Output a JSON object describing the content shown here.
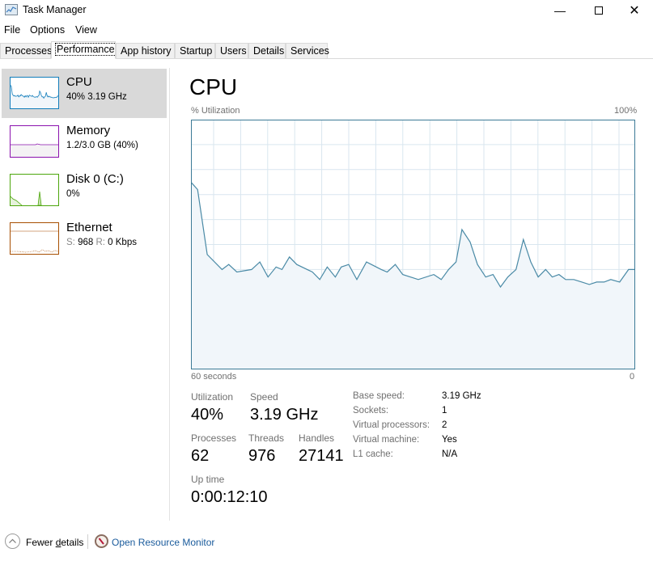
{
  "window": {
    "title": "Task Manager",
    "controls": [
      "minimize",
      "maximize",
      "close"
    ]
  },
  "menu": [
    "File",
    "Options",
    "View"
  ],
  "tabs": [
    {
      "label": "Processes",
      "active": false
    },
    {
      "label": "Performance",
      "active": true
    },
    {
      "label": "App history",
      "active": false
    },
    {
      "label": "Startup",
      "active": false
    },
    {
      "label": "Users",
      "active": false
    },
    {
      "label": "Details",
      "active": false
    },
    {
      "label": "Services",
      "active": false
    }
  ],
  "sidebar": {
    "items": [
      {
        "name": "CPU",
        "detail": "40% 3.19 GHz",
        "color": "#117dbb",
        "selected": true
      },
      {
        "name": "Memory",
        "detail": "1.2/3.0 GB (40%)",
        "color": "#8b12ae",
        "selected": false
      },
      {
        "name": "Disk 0 (C:)",
        "detail": "0%",
        "color": "#4da60c",
        "selected": false
      },
      {
        "name": "Ethernet",
        "detail_s_label": "S:",
        "detail_s_value": "968",
        "detail_r_label": "R:",
        "detail_r_value": "0 Kbps",
        "color": "#a74f01",
        "selected": false
      }
    ]
  },
  "main": {
    "title": "CPU",
    "y_label": "% Utilization",
    "y_max_label": "100%",
    "x_left_label": "60 seconds",
    "x_right_label": "0",
    "stats": {
      "utilization_label": "Utilization",
      "utilization_value": "40%",
      "speed_label": "Speed",
      "speed_value": "3.19 GHz",
      "processes_label": "Processes",
      "processes_value": "62",
      "threads_label": "Threads",
      "threads_value": "976",
      "handles_label": "Handles",
      "handles_value": "27141",
      "uptime_label": "Up time",
      "uptime_value": "0:00:12:10"
    },
    "specs": [
      {
        "key": "Base speed:",
        "value": "3.19 GHz"
      },
      {
        "key": "Sockets:",
        "value": "1"
      },
      {
        "key": "Virtual processors:",
        "value": "2"
      },
      {
        "key": "Virtual machine:",
        "value": "Yes"
      },
      {
        "key": "L1 cache:",
        "value": "N/A"
      }
    ]
  },
  "footer": {
    "fewer_details_pre": "Fewer ",
    "fewer_details_ul": "d",
    "fewer_details_post": "etails",
    "open_resource_monitor": "Open Resource Monitor"
  },
  "chart_data": {
    "type": "area",
    "title": "CPU % Utilization",
    "xlabel": "60 seconds",
    "ylabel": "% Utilization",
    "x_range": [
      60,
      0
    ],
    "ylim": [
      0,
      100
    ],
    "grid": true,
    "color": "#117dbb",
    "series": [
      {
        "name": "CPU",
        "x": [
          60,
          59.1,
          57.8,
          55.8,
          54.9,
          53.8,
          51.8,
          50.7,
          49.6,
          48.5,
          47.7,
          46.7,
          45.7,
          43.6,
          42.6,
          41.6,
          40.5,
          39.7,
          38.7,
          37.6,
          36.3,
          34.3,
          33.5,
          32.4,
          31.4,
          29.3,
          27.2,
          26.2,
          25.2,
          24.2,
          23.4,
          22.3,
          21.3,
          20.2,
          19.2,
          18.2,
          17.2,
          16.1,
          15.1,
          14.1,
          13.1,
          12.1,
          11.2,
          10.3,
          9.4,
          8.3,
          7.2,
          6.2,
          5.2,
          4.2,
          3.3,
          2.1,
          0.9,
          0
        ],
        "values": [
          75,
          72,
          46,
          40,
          42,
          39,
          40,
          43,
          37,
          41,
          40,
          45,
          42,
          39,
          36,
          41,
          37,
          41,
          42,
          36,
          43,
          40,
          39,
          42,
          38,
          36,
          38,
          36,
          40,
          43,
          56,
          51,
          42,
          37,
          38,
          33,
          37,
          40,
          52,
          43,
          37,
          40,
          37,
          38,
          36,
          36,
          35,
          34,
          35,
          35,
          36,
          35,
          40,
          40
        ]
      }
    ]
  }
}
